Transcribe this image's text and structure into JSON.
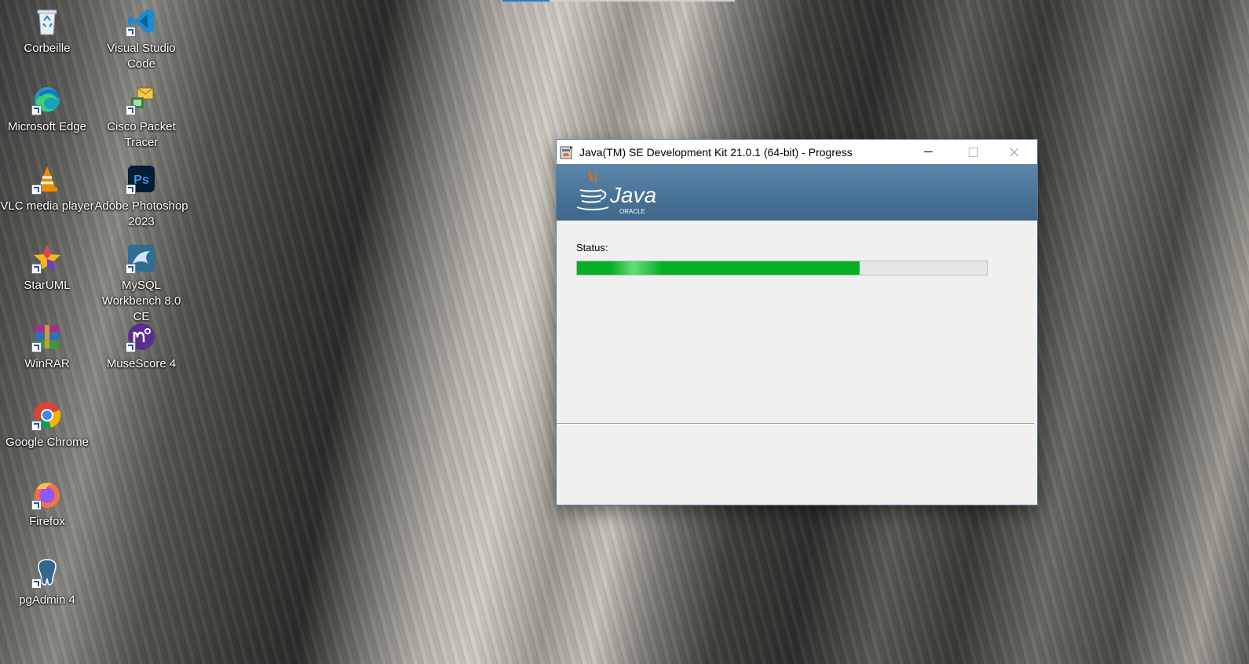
{
  "desktop": {
    "icons": [
      {
        "label": "Corbeille",
        "icon": "recycle-bin-icon"
      },
      {
        "label": "Visual Studio Code",
        "icon": "vscode-icon"
      },
      {
        "label": "Microsoft Edge",
        "icon": "edge-icon"
      },
      {
        "label": "Cisco Packet Tracer",
        "icon": "packet-tracer-icon"
      },
      {
        "label": "VLC media player",
        "icon": "vlc-icon"
      },
      {
        "label": "Adobe Photoshop 2023",
        "icon": "photoshop-icon"
      },
      {
        "label": "StarUML",
        "icon": "staruml-icon"
      },
      {
        "label": "MySQL Workbench 8.0 CE",
        "icon": "mysql-workbench-icon"
      },
      {
        "label": "WinRAR",
        "icon": "winrar-icon"
      },
      {
        "label": "MuseScore 4",
        "icon": "musescore-icon"
      },
      {
        "label": "Google Chrome",
        "icon": "chrome-icon"
      },
      {
        "label": "Firefox",
        "icon": "firefox-icon"
      },
      {
        "label": "pgAdmin 4",
        "icon": "pgadmin-icon"
      }
    ]
  },
  "installer": {
    "title": "Java(TM) SE Development Kit 21.0.1 (64-bit) - Progress",
    "logo_text": "Java",
    "logo_sub": "ORACLE",
    "status_label": "Status:",
    "progress_fraction": 0.69,
    "controls": {
      "minimize": "minimize-icon",
      "maximize": "maximize-icon",
      "close": "close-icon"
    },
    "colors": {
      "banner": "#4a7497",
      "progress": "#06b025",
      "logo_accent": "#e76f00"
    }
  }
}
